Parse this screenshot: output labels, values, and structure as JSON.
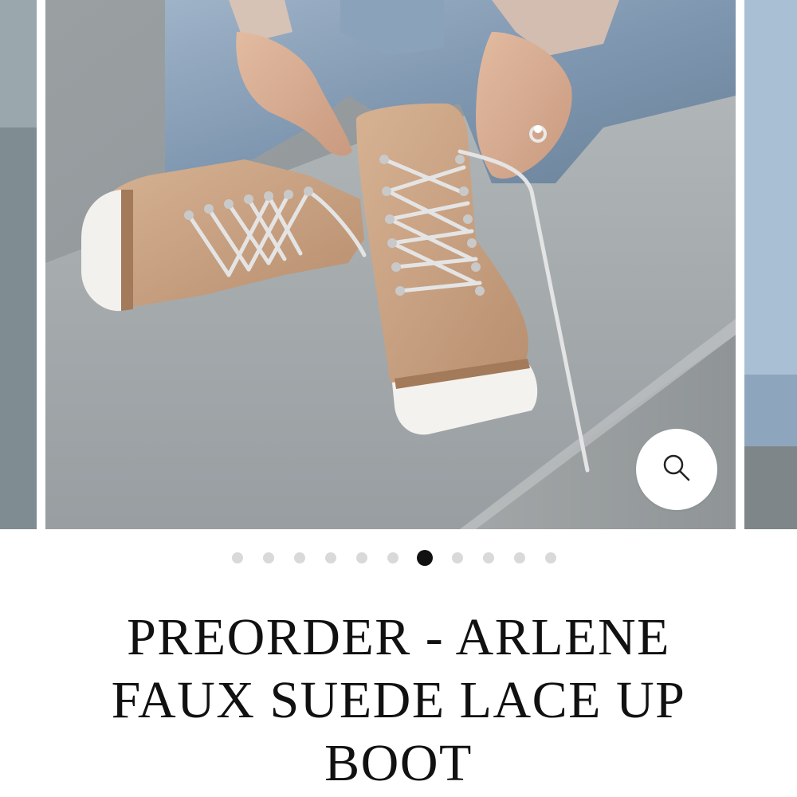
{
  "product": {
    "title": "PREORDER - ARLENE FAUX SUEDE LACE UP BOOT"
  },
  "gallery": {
    "image_subject": "tan faux suede lace-up boots with white lug soles",
    "total_images": 11,
    "active_index": 7,
    "zoom_icon": "magnifier-icon"
  },
  "colors": {
    "background": "#ffffff",
    "text": "#111111",
    "dot_inactive": "#d9d9d9",
    "dot_active": "#111111"
  }
}
